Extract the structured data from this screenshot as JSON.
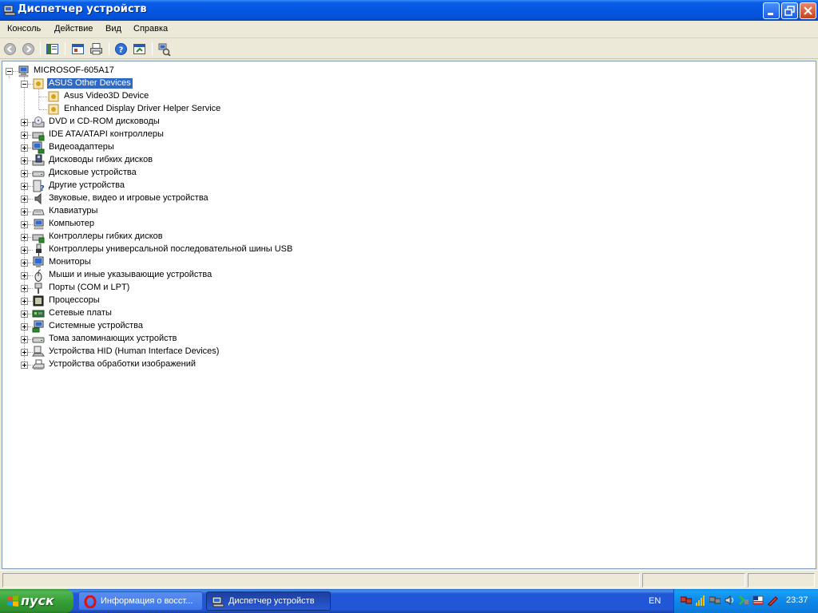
{
  "window": {
    "title": "Диспетчер устройств",
    "buttons": {
      "minimize": "minimize",
      "maximize": "restore",
      "close": "close"
    }
  },
  "menu": [
    "Консоль",
    "Действие",
    "Вид",
    "Справка"
  ],
  "toolbar": {
    "icons": [
      "back-icon",
      "forward-icon",
      "show-hide-tree-icon",
      "properties-icon",
      "print-icon",
      "help-icon",
      "export-icon",
      "scan-hardware-icon"
    ]
  },
  "tree": {
    "root": "MICROSOF-605A17",
    "expanded_category": {
      "label": "ASUS Other Devices",
      "children": [
        "Asus Video3D Device",
        "Enhanced Display Driver Helper Service"
      ]
    },
    "categories": [
      "DVD и CD-ROM дисководы",
      "IDE ATA/ATAPI контроллеры",
      "Видеоадаптеры",
      "Дисководы гибких дисков",
      "Дисковые устройства",
      "Другие устройства",
      "Звуковые, видео и игровые устройства",
      "Клавиатуры",
      "Компьютер",
      "Контроллеры гибких дисков",
      "Контроллеры универсальной последовательной шины USB",
      "Мониторы",
      "Мыши и иные указывающие устройства",
      "Порты (COM и LPT)",
      "Процессоры",
      "Сетевые платы",
      "Системные устройства",
      "Тома запоминающих устройств",
      "Устройства HID (Human Interface Devices)",
      "Устройства обработки изображений"
    ]
  },
  "taskbar": {
    "start_label": "пуск",
    "tasks": [
      {
        "label": "Информация о восст...",
        "icon": "opera-icon",
        "active": false
      },
      {
        "label": "Диспетчер устройств",
        "icon": "device-manager-icon",
        "active": true
      }
    ],
    "language": "EN",
    "clock": "23:37"
  },
  "colors": {
    "titlebar": "#0456e0",
    "selection": "#316ac5",
    "taskbar": "#2157d7",
    "start_button": "#36a136",
    "tray": "#0f88ea"
  }
}
